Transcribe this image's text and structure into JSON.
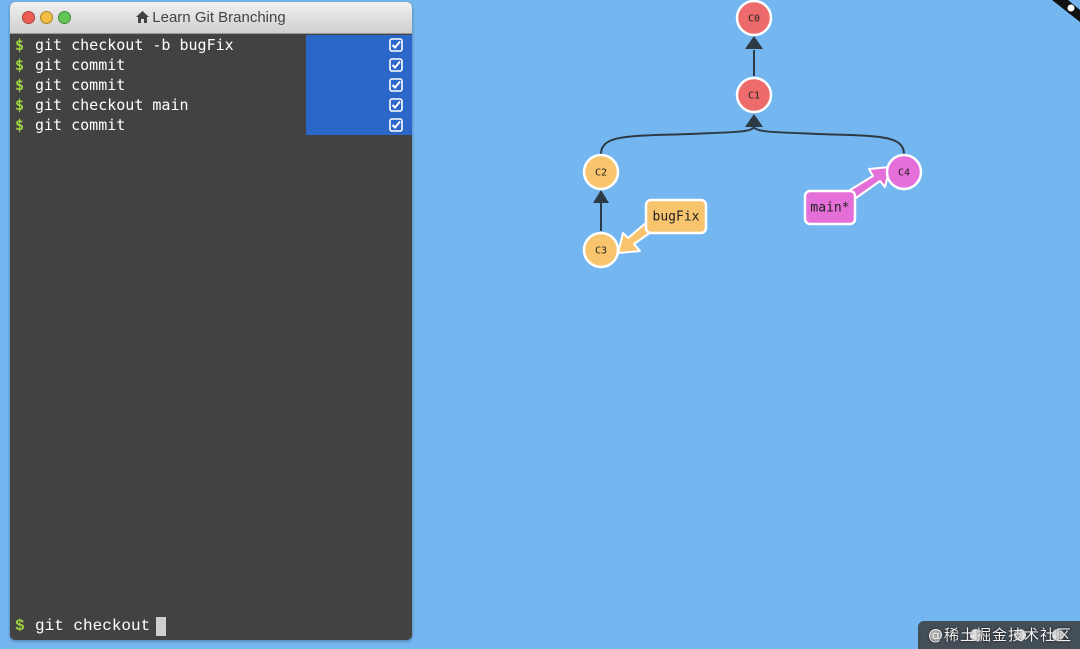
{
  "window": {
    "title": "Learn Git Branching",
    "home_icon": "home-icon"
  },
  "commands": [
    {
      "prompt": "$",
      "text": "git checkout -b bugFix",
      "status": "done"
    },
    {
      "prompt": "$",
      "text": "git commit",
      "status": "done"
    },
    {
      "prompt": "$",
      "text": "git commit",
      "status": "done"
    },
    {
      "prompt": "$",
      "text": "git checkout main",
      "status": "done"
    },
    {
      "prompt": "$",
      "text": "git commit",
      "status": "done"
    }
  ],
  "input": {
    "prompt": "$",
    "value": "git checkout"
  },
  "graph": {
    "commits": [
      "C0",
      "C1",
      "C2",
      "C3",
      "C4"
    ],
    "branches": [
      "bugFix",
      "main*"
    ]
  },
  "colors": {
    "background": "#74b6f0",
    "terminal": "#424242",
    "done_highlight": "#2b66c9",
    "prompt": "#9fd341",
    "main_branch": "#e56fd8",
    "bugfix_branch": "#f8c56e",
    "base_commit": "#ee6b6b"
  },
  "watermark": {
    "text": "@稀土掘金技术社区"
  }
}
